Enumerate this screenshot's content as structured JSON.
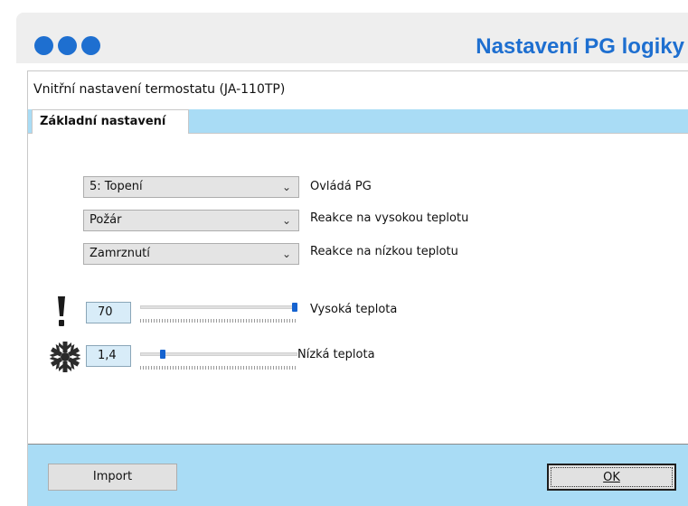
{
  "header": {
    "title": "Nastavení PG logiky",
    "accent": "#1e6fd0"
  },
  "window": {
    "title": "Vnitřní nastavení termostatu (JA-110TP)",
    "tab": "Základní nastavení"
  },
  "combos": [
    {
      "value": "5: Topení",
      "label": "Ovládá PG"
    },
    {
      "value": "Požár",
      "label": "Reakce na vysokou teplotu"
    },
    {
      "value": "Zamrznutí",
      "label": "Reakce na nízkou teplotu"
    }
  ],
  "sliders": {
    "high": {
      "icon": "exclamation-icon",
      "value": "70",
      "level": 1.0,
      "label": "Vysoká teplota"
    },
    "low": {
      "icon": "snowflake-icon",
      "value": "1,4",
      "level": 0.12,
      "label": "Nízká teplota"
    }
  },
  "buttons": {
    "import": "Import",
    "ok": "OK"
  },
  "colors": {
    "tab_strip": "#a9dcf5",
    "slider_thumb": "#1563d0"
  }
}
